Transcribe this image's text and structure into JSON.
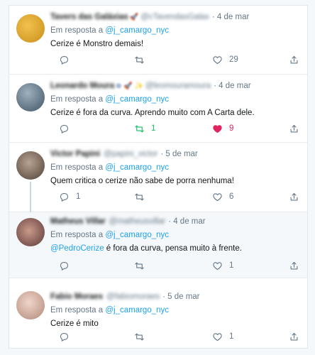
{
  "tweets": [
    {
      "name": "Tavers das Galáxias",
      "badges": "🚀",
      "handle": "@cTavendasGalax",
      "date": "· 4 de mar",
      "reply_prefix": "Em resposta a ",
      "reply_to": "@j_camargo_nyc",
      "mention": "",
      "text": "Cerize é Monstro demais!",
      "reply_count": "",
      "retweet_count": "",
      "like_count": "29",
      "avatar_color": "#d9a832"
    },
    {
      "name": "Leonardo Moura",
      "badges": "⊕ 🚀 ✨",
      "handle": "@leomouramoura",
      "date": "· 4 de mar",
      "reply_prefix": "Em resposta a ",
      "reply_to": "@j_camargo_nyc",
      "mention": "",
      "text": "Cerize é fora da curva. Aprendo muito com A Carta dele.",
      "reply_count": "",
      "retweet_count": "1",
      "like_count": "9",
      "avatar_color": "#6b7f8f"
    },
    {
      "name": "Victor Papini",
      "badges": "",
      "handle": "@papini_victor",
      "date": "· 5 de mar",
      "reply_prefix": "Em resposta a ",
      "reply_to": "@j_camargo_nyc",
      "mention": "",
      "text": "Quem critica o cerize não sabe de porra nenhuma!",
      "reply_count": "1",
      "retweet_count": "",
      "like_count": "6",
      "avatar_color": "#7a6a5c"
    },
    {
      "name": "Matheus Villar",
      "badges": "",
      "handle": "@matheusvillar",
      "date": "· 4 de mar",
      "reply_prefix": "Em resposta a ",
      "reply_to": "@j_camargo_nyc",
      "mention": "@PedroCerize",
      "text": " é fora da curva, pensa muito à frente.",
      "reply_count": "",
      "retweet_count": "",
      "like_count": "1",
      "avatar_color": "#8a5a5a"
    },
    {
      "name": "Fabio Moraes",
      "badges": "",
      "handle": "@fabiomoraes",
      "date": "· 5 de mar",
      "reply_prefix": "Em resposta a ",
      "reply_to": "@j_camargo_nyc",
      "mention": "",
      "text": "Cerize é mito",
      "reply_count": "",
      "retweet_count": "",
      "like_count": "1",
      "avatar_color": "#c9a89a"
    }
  ],
  "colors": {
    "link": "#1da1f2",
    "muted": "#657786",
    "retweet_active": "#17bf63",
    "like_active": "#e0245e"
  },
  "icons": {
    "reply": "reply-icon",
    "retweet": "retweet-icon",
    "like": "heart-icon",
    "share": "share-icon"
  }
}
